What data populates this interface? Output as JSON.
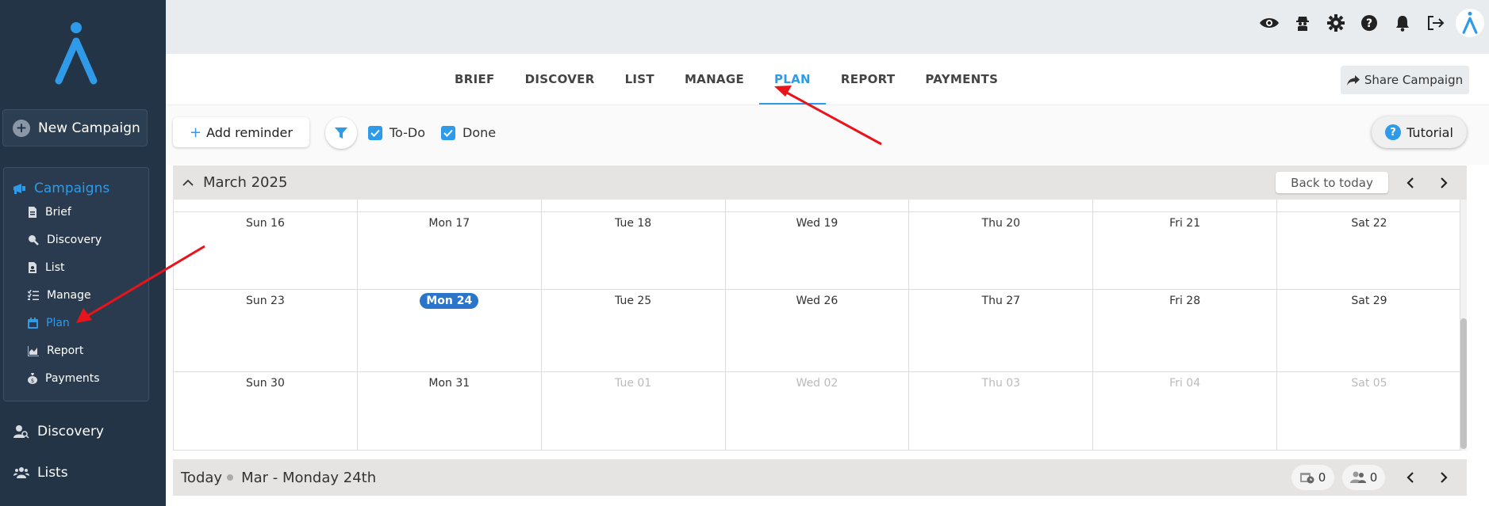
{
  "sidebar": {
    "new_campaign": "New Campaign",
    "campaigns_label": "Campaigns",
    "sub_items": [
      "Brief",
      "Discovery",
      "List",
      "Manage",
      "Plan",
      "Report",
      "Payments"
    ],
    "active_sub_item": "Plan",
    "discovery": "Discovery",
    "lists": "Lists"
  },
  "topbar": {
    "icons": [
      "eye-icon",
      "spy-icon",
      "gear-icon",
      "help-icon",
      "bell-icon",
      "logout-icon",
      "brand-logo-icon"
    ]
  },
  "tabs": [
    "BRIEF",
    "DISCOVER",
    "LIST",
    "MANAGE",
    "PLAN",
    "REPORT",
    "PAYMENTS"
  ],
  "active_tab": "PLAN",
  "share_campaign": "Share Campaign",
  "toolbar": {
    "add_reminder": "Add reminder",
    "todo": "To-Do",
    "done": "Done",
    "tutorial": "Tutorial"
  },
  "calendar": {
    "month": "March 2025",
    "back_to_today": "Back to today",
    "weeks": [
      [
        {
          "label": "Sun 16"
        },
        {
          "label": "Mon 17"
        },
        {
          "label": "Tue 18"
        },
        {
          "label": "Wed 19"
        },
        {
          "label": "Thu 20"
        },
        {
          "label": "Fri 21"
        },
        {
          "label": "Sat 22"
        }
      ],
      [
        {
          "label": "Sun 23"
        },
        {
          "label": "Mon 24",
          "today": true
        },
        {
          "label": "Tue 25"
        },
        {
          "label": "Wed 26"
        },
        {
          "label": "Thu 27"
        },
        {
          "label": "Fri 28"
        },
        {
          "label": "Sat 29"
        }
      ],
      [
        {
          "label": "Sun 30"
        },
        {
          "label": "Mon 31"
        },
        {
          "label": "Tue 01",
          "muted": true
        },
        {
          "label": "Wed 02",
          "muted": true
        },
        {
          "label": "Thu 03",
          "muted": true
        },
        {
          "label": "Fri 04",
          "muted": true
        },
        {
          "label": "Sat 05",
          "muted": true
        }
      ]
    ]
  },
  "bottom": {
    "today": "Today",
    "date": "Mar - Monday 24th",
    "reminders_count": "0",
    "people_count": "0"
  },
  "colors": {
    "accent": "#2f9be8",
    "sidebar_bg": "#243447",
    "today_badge": "#2a74c9",
    "annotation": "#e8141c"
  }
}
